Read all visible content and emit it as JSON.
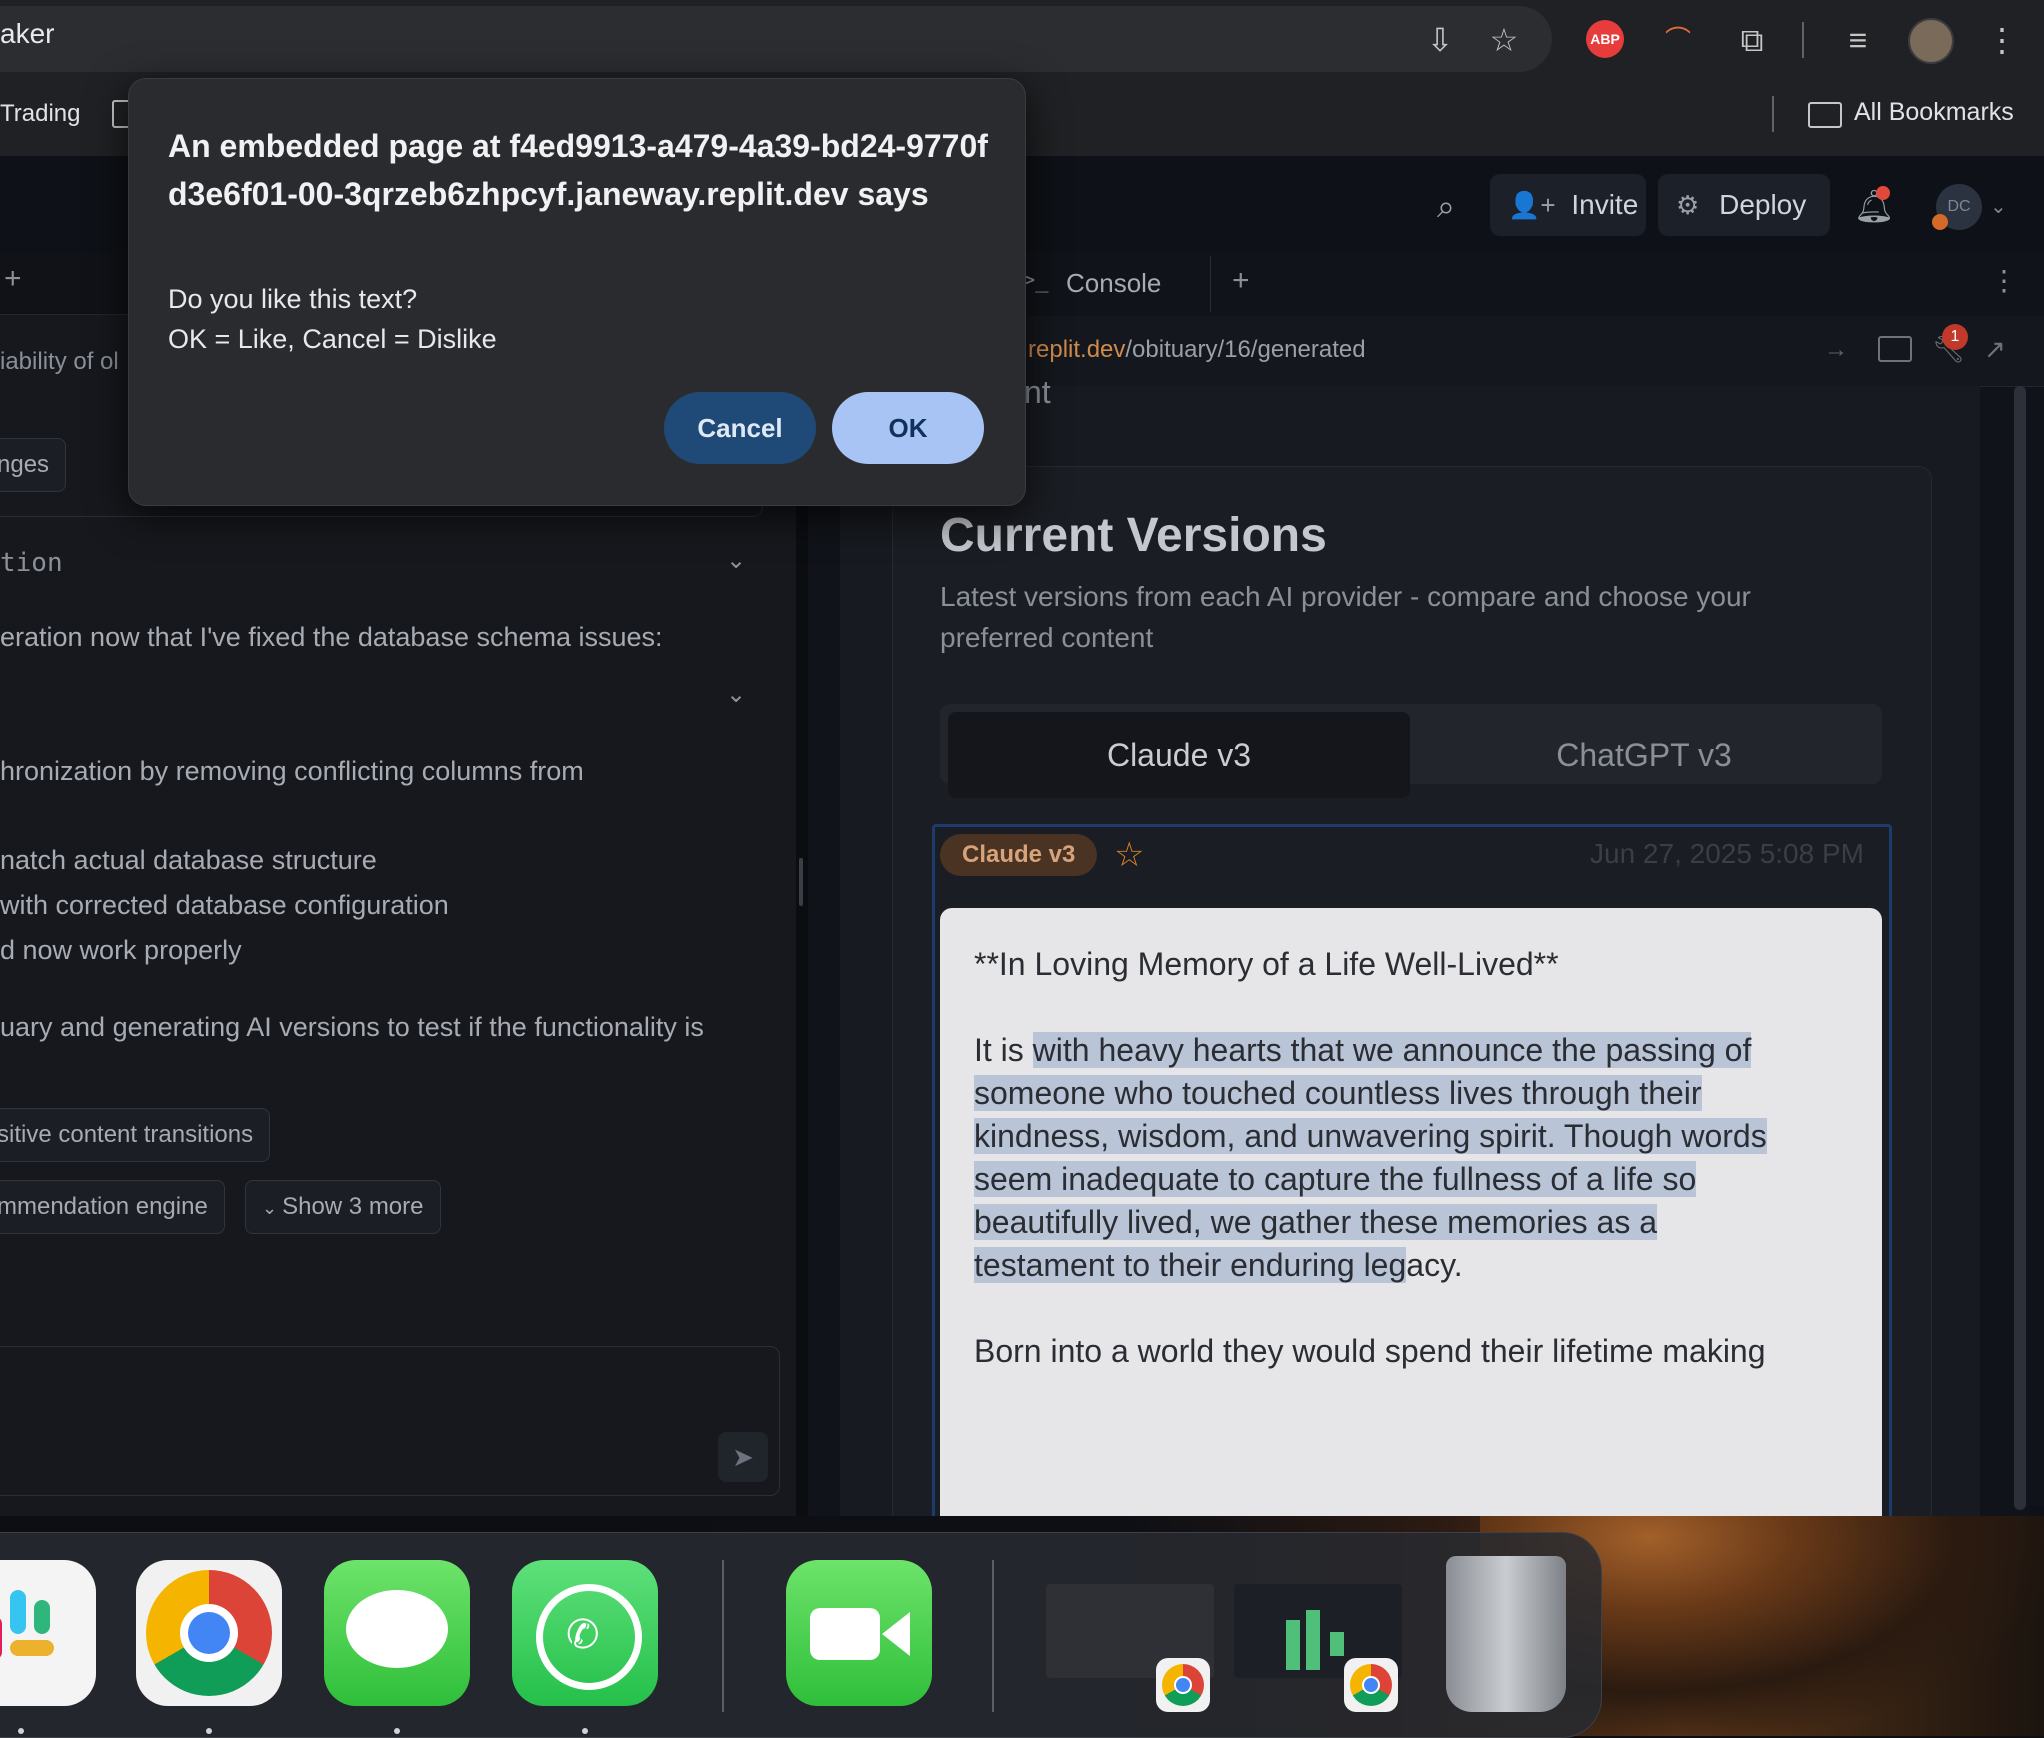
{
  "browser": {
    "omnibox_text": "aker",
    "bookmark_trading": "Trading",
    "all_bookmarks": "All Bookmarks",
    "abp_label": "ABP"
  },
  "replit": {
    "invite_label": "Invite",
    "deploy_label": "Deploy",
    "avatar_initials": "DC",
    "notification_count": "1",
    "console_tab": "Console",
    "url_host": "replit.dev",
    "url_path": "/obituary/16/generated",
    "behind_dialog_text": "nt",
    "left_pane": {
      "partial_header": "iability of ol",
      "chip_changes": "nges",
      "code_heading": "tion",
      "line1": "eration now that I've fixed the database schema issues:",
      "line2": "hronization by removing conflicting columns from",
      "line3": "natch actual database structure",
      "line4": " with corrected database configuration",
      "line5": "d now work properly",
      "line6": "uary and generating AI versions to test if the functionality is",
      "chip_transitions": "sitive content transitions",
      "chip_engine": "mmendation engine",
      "show_more": "Show 3 more"
    },
    "preview": {
      "title": "Current Versions",
      "subtitle_line1": "Latest versions from each AI provider - compare and choose your",
      "subtitle_line2": "preferred content",
      "tabs": [
        "Claude v3",
        "ChatGPT v3"
      ],
      "badge": "Claude v3",
      "timestamp": "Jun 27, 2025 5:08 PM",
      "content_heading": "**In Loving Memory of a Life Well-Lived**",
      "content_lines": [
        "It is with heavy hearts that we announce the passing of",
        "someone who touched countless lives through their",
        "kindness, wisdom, and unwavering spirit. Though words",
        "seem inadequate to capture the fullness of a life so",
        "beautifully lived, we gather these memories as a",
        "testament to their enduring legacy."
      ],
      "content_next": "Born into a world they would spend their lifetime making"
    }
  },
  "dialog": {
    "title": "An embedded page at f4ed9913-a479-4a39-bd24-9770fd3e6f01-00-3qrzeb6zhpcyf.janeway.replit.dev says",
    "line1": "Do you like this text?",
    "line2": "OK = Like, Cancel = Dislike",
    "cancel_label": "Cancel",
    "ok_label": "OK"
  },
  "dock": {
    "apps": [
      "slack",
      "chrome",
      "messages",
      "whatsapp",
      "facetime",
      "chrome-window-1",
      "chrome-window-2",
      "trash"
    ]
  },
  "colors": {
    "ok_button": "#a8c4f4",
    "cancel_button": "#1f4a78",
    "badge": "#4a3322",
    "highlight": "#b9c4d6"
  }
}
